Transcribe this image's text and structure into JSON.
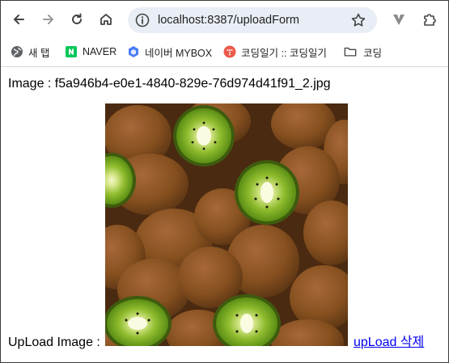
{
  "browser": {
    "url": "localhost:8387/uploadForm",
    "icons": {
      "back": "arrow-left-icon",
      "forward": "arrow-right-icon",
      "reload": "reload-icon",
      "home": "home-icon",
      "site_info": "tune-icon",
      "bookmark": "star-icon",
      "extension": "v-extension-icon",
      "extensions_menu": "puzzle-icon"
    }
  },
  "bookmarks": [
    {
      "label": "새 탭",
      "icon": "globe-icon"
    },
    {
      "label": "NAVER",
      "icon": "naver-icon"
    },
    {
      "label": "네이버 MYBOX",
      "icon": "mybox-icon"
    },
    {
      "label": "코딩일기 :: 코딩일기",
      "icon": "tistory-icon"
    },
    {
      "label": "코딩",
      "icon": "folder-icon"
    }
  ],
  "page": {
    "image_name": "Image : f5a946b4-e0e1-4840-829e-76d974d41f91_2.jpg",
    "upload_label": "UpLoad Image : ",
    "delete_link": "upLoad 삭제"
  },
  "colors": {
    "omnibox_bg": "#e9eef6",
    "link": "#0000ee",
    "naver_green": "#03c75a",
    "mybox_blue": "#4a7cf6",
    "tistory_red": "#eb5a4b"
  }
}
